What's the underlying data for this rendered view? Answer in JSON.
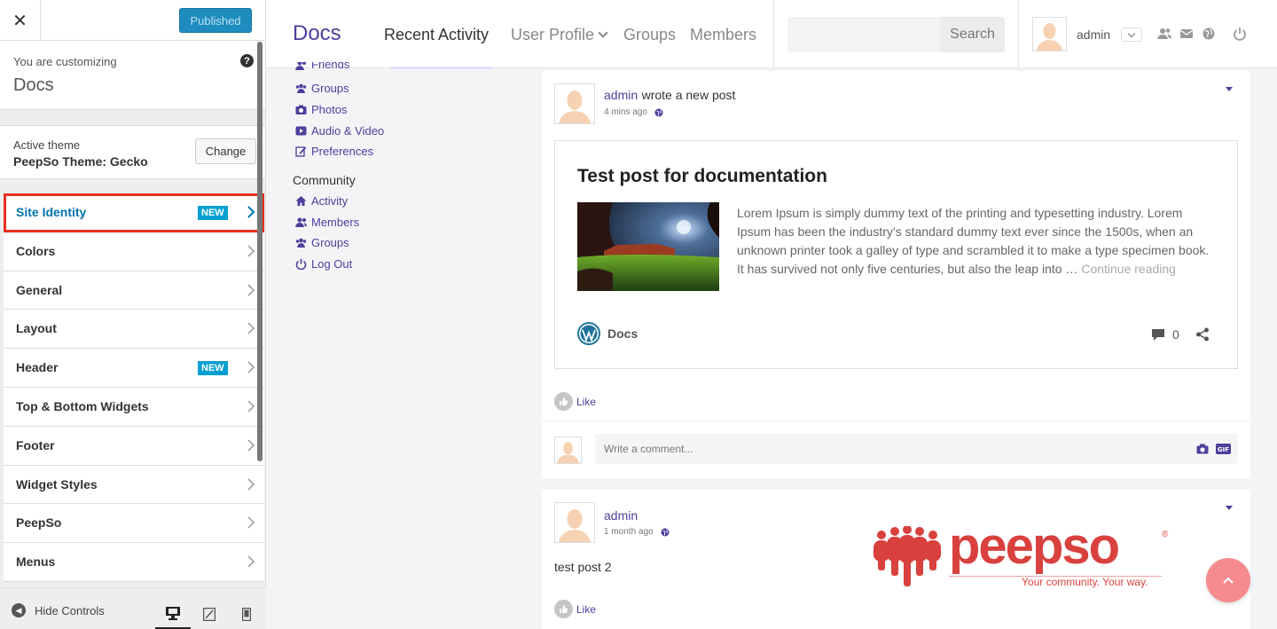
{
  "customizer": {
    "close_glyph": "✕",
    "publish_label": "Published",
    "customizing_label": "You are customizing",
    "site_name": "Docs",
    "help_glyph": "?",
    "active_theme_label": "Active theme",
    "theme_name": "PeepSo Theme: Gecko",
    "change_label": "Change",
    "sections": [
      {
        "label": "Site Identity",
        "badge": "NEW",
        "active": true
      },
      {
        "label": "Colors"
      },
      {
        "label": "General"
      },
      {
        "label": "Layout"
      },
      {
        "label": "Header",
        "badge": "NEW"
      },
      {
        "label": "Top & Bottom Widgets"
      },
      {
        "label": "Footer"
      },
      {
        "label": "Widget Styles"
      },
      {
        "label": "PeepSo"
      },
      {
        "label": "Menus"
      }
    ],
    "hide_controls_label": "Hide Controls",
    "preview_device": "desktop"
  },
  "header": {
    "brand": "Docs",
    "nav": [
      "Recent Activity",
      "User Profile",
      "Groups",
      "Members"
    ],
    "search_placeholder": "",
    "search_button": "Search",
    "username": "admin"
  },
  "sidebar": {
    "profile_items": [
      {
        "label": "Friends",
        "icon": "friends-icon"
      },
      {
        "label": "Groups",
        "icon": "groups-icon"
      },
      {
        "label": "Photos",
        "icon": "camera-icon"
      },
      {
        "label": "Audio & Video",
        "icon": "video-icon"
      },
      {
        "label": "Preferences",
        "icon": "edit-icon"
      }
    ],
    "community_heading": "Community",
    "community_items": [
      {
        "label": "Activity",
        "icon": "home-icon"
      },
      {
        "label": "Members",
        "icon": "members-icon"
      },
      {
        "label": "Groups",
        "icon": "groups-icon"
      },
      {
        "label": "Log Out",
        "icon": "power-icon"
      }
    ]
  },
  "posts": [
    {
      "author": "admin",
      "action": "wrote a new post",
      "time": "4 mins ago",
      "embed_title": "Test post for documentation",
      "embed_excerpt": "Lorem Ipsum is simply dummy text of the printing and typesetting industry. Lorem Ipsum has been the industry’s standard dummy text ever since the 1500s, when an unknown printer took a galley of type and scrambled it to make a type specimen book. It has survived not only five centuries, but also the leap into … ",
      "continue_label": "Continue reading",
      "source": "Docs",
      "comment_count": "0",
      "like_label": "Like",
      "comment_placeholder": "Write a comment..."
    },
    {
      "author": "admin",
      "time": "1 month ago",
      "content": "test post 2",
      "like_label": "Like"
    }
  ],
  "logo": {
    "wordmark": "peepso",
    "reg": "®",
    "tagline": "Your community. Your way."
  },
  "colors": {
    "accent": "#4d3f9b",
    "publish": "#1e8cbe",
    "badge": "#00a0d2",
    "highlight": "#e8301c",
    "logo_red": "#d9413e",
    "fab": "#f58b90"
  }
}
